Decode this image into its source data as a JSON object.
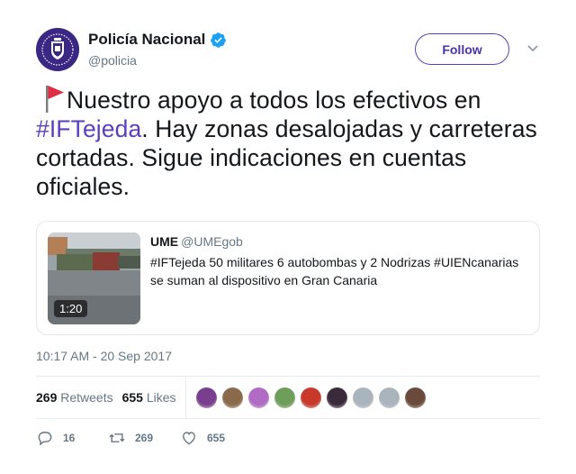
{
  "user": {
    "display_name": "Policía Nacional",
    "handle": "@policia",
    "avatar_icon": "police-shield-emblem",
    "verified_icon": "verified-badge-icon"
  },
  "follow_label": "Follow",
  "tweet": {
    "emoji_icon": "red-flag-icon",
    "text_before": "Nuestro apoyo a todos los efectivos en ",
    "hashtag": "#IFTejeda",
    "text_after": ". Hay zonas desalojadas y carreteras cortadas. Sigue indicaciones en cuentas oficiales."
  },
  "quoted": {
    "name": "UME",
    "handle": "@UMEgob",
    "text": "#IFTejeda 50 militares 6 autobombas y 2 Nodrizas #UIENcanarias se suman al dispositivo en Gran Canaria",
    "video_duration": "1:20"
  },
  "timestamp": "10:17 AM - 20 Sep 2017",
  "stats": {
    "retweets_count": "269",
    "retweets_label": "Retweets",
    "likes_count": "655",
    "likes_label": "Likes"
  },
  "actions": {
    "reply_count": "16",
    "retweet_count": "269",
    "like_count": "655"
  },
  "colors": {
    "accent": "#5b3fbf",
    "verified": "#1da1f2",
    "muted": "#657786",
    "border": "#e1e8ed"
  },
  "liker_faces": [
    "#7a3e8f",
    "#8a6a4a",
    "#b06cc4",
    "#6f9e5b",
    "#c8392b",
    "#3a2a3a",
    "#aab4bd",
    "#aab4bd",
    "#6a4a3a"
  ]
}
